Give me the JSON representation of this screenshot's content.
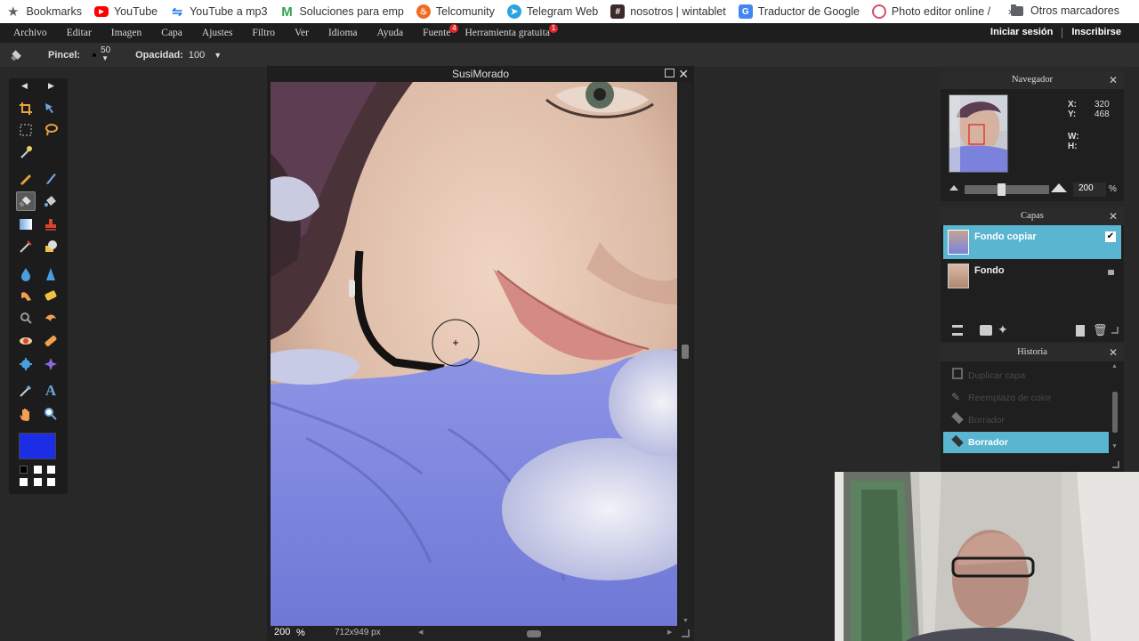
{
  "bookmarks": {
    "items": [
      {
        "label": "Bookmarks",
        "icon": "star-icon",
        "color": "#5f6368"
      },
      {
        "label": "YouTube",
        "icon": "youtube-icon",
        "color": "#ff0000"
      },
      {
        "label": "YouTube a mp3",
        "icon": "sync-icon",
        "color": "#1a73e8"
      },
      {
        "label": "Soluciones para emp",
        "icon": "m-logo-icon",
        "color": "#2ea44f"
      },
      {
        "label": "Telcomunity",
        "icon": "flame-icon",
        "color": "#f26a21"
      },
      {
        "label": "Telegram Web",
        "icon": "telegram-icon",
        "color": "#2aa3df"
      },
      {
        "label": "nosotros | wintablet",
        "icon": "hash-icon",
        "color": "#3d2b2b"
      },
      {
        "label": "Traductor de Google",
        "icon": "translate-icon",
        "color": "#4285f4"
      },
      {
        "label": "Photo editor online /",
        "icon": "photo-editor-icon",
        "color": "#d44f6a"
      }
    ],
    "more": "»",
    "other": "Otros marcadores"
  },
  "menubar": {
    "items": [
      "Archivo",
      "Editar",
      "Imagen",
      "Capa",
      "Ajustes",
      "Filtro",
      "Ver",
      "Idioma",
      "Ayuda",
      "Fuente",
      "Herramienta gratuita"
    ],
    "badges": {
      "fuente": "4",
      "herramienta": "1"
    },
    "login": "Iniciar sesión",
    "signup": "Inscribirse"
  },
  "options": {
    "brush_label": "Pincel:",
    "brush_size": "50",
    "opacity_label": "Opacidad:",
    "opacity_value": "100"
  },
  "tools": {
    "primary_color": "#1b2ee6",
    "secondary_color": "#000000"
  },
  "canvas": {
    "title": "SusiMorado",
    "zoom": "200",
    "zoom_unit": "%",
    "dimensions": "712x949 px"
  },
  "navigator": {
    "title": "Navegador",
    "x_label": "X:",
    "x_value": "320",
    "y_label": "Y:",
    "y_value": "468",
    "w_label": "W:",
    "h_label": "H:",
    "zoom_value": "200",
    "zoom_unit": "%"
  },
  "layers": {
    "title": "Capas",
    "items": [
      {
        "name": "Fondo copiar",
        "checked": true
      },
      {
        "name": "Fondo",
        "locked": true
      }
    ]
  },
  "history": {
    "title": "Historia",
    "items": [
      "Duplicar capa",
      "Reemplazo de color",
      "Borrador",
      "Borrador"
    ],
    "active_index": 3
  }
}
